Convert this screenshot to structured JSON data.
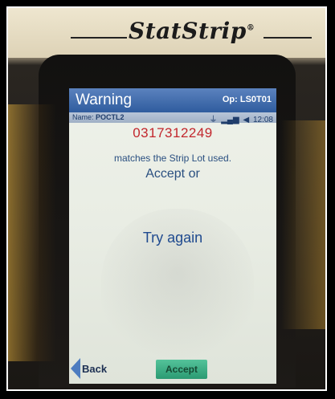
{
  "device": {
    "brand": "StatStrip",
    "brand_mark": "®"
  },
  "screen": {
    "title": "Warning",
    "operator": "Op: LS0T01",
    "name_label": "Name:",
    "name_value": "POCTL2",
    "status_icons": [
      "usb-icon",
      "signal-bars-icon",
      "speaker-icon"
    ],
    "time": "12:08",
    "lot_number": "0317312249",
    "message_line1": "matches the Strip Lot used.",
    "message_line2": "Accept or",
    "try_again": "Try again",
    "back_label": "Back",
    "accept_label": "Accept",
    "colors": {
      "title_bar": "#2f5c9e",
      "lot_text": "#c2272d",
      "accept_button": "#2b9a72"
    }
  }
}
